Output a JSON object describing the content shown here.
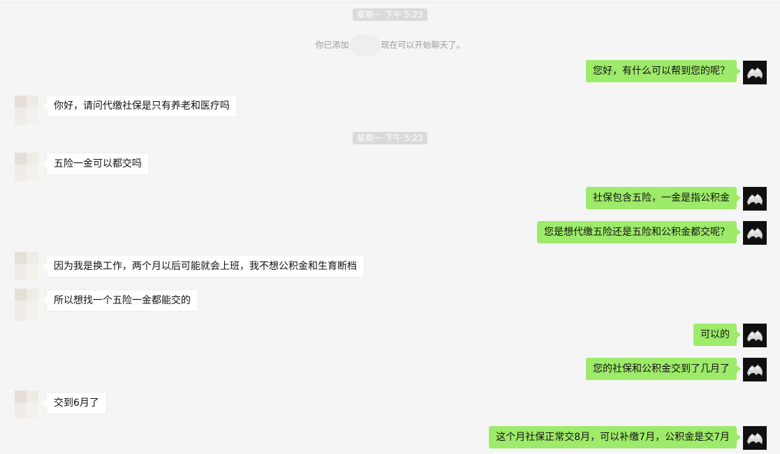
{
  "timestamps": [
    "星期一 下午 5:23",
    "星期一 下午 5:23"
  ],
  "system_notice": {
    "before": "你已添加",
    "after": "现在可以开始聊天了。"
  },
  "messages": [
    {
      "side": "right",
      "text": "您好，有什么可以帮到您的呢？"
    },
    {
      "side": "left",
      "text": "你好，请问代缴社保是只有养老和医疗吗"
    },
    {
      "side": "left",
      "text": "五险一金可以都交吗"
    },
    {
      "side": "right",
      "text": "社保包含五险，一金是指公积金"
    },
    {
      "side": "right",
      "text": "您是想代缴五险还是五险和公积金都交呢？"
    },
    {
      "side": "left",
      "text": "因为我是换工作，两个月以后可能就会上班，我不想公积金和生育断档"
    },
    {
      "side": "left",
      "text": "所以想找一个五险一金都能交的"
    },
    {
      "side": "right",
      "text": "可以的"
    },
    {
      "side": "right",
      "text": "您的社保和公积金交到了几月了"
    },
    {
      "side": "left",
      "text": "交到6月了"
    },
    {
      "side": "right",
      "text": "这个月社保正常交8月，可以补缴7月，公积金是交7月"
    }
  ],
  "colors": {
    "background": "#f5f5f5",
    "sent_bubble": "#9eea6a",
    "received_bubble": "#ffffff",
    "timestamp_bg": "#dadada"
  }
}
